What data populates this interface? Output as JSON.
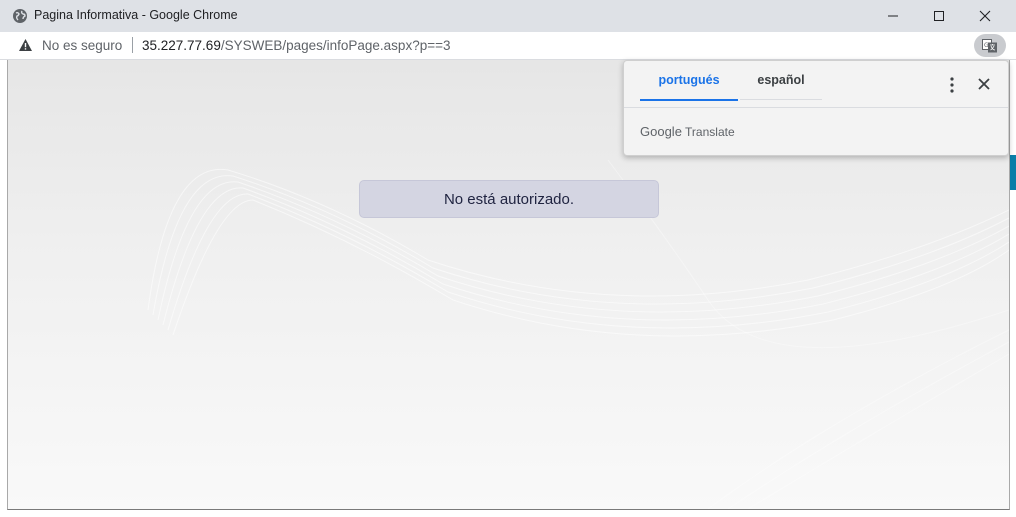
{
  "window": {
    "title": "Pagina Informativa - Google Chrome",
    "controls": [
      "minimize",
      "maximize",
      "close"
    ]
  },
  "addressbar": {
    "security_label": "No es seguro",
    "url_host": "35.227.77.69",
    "url_path": "/SYSWEB/pages/infoPage.aspx?p==3",
    "icons": [
      "warning-icon",
      "translate-icon"
    ]
  },
  "page": {
    "message": "No está autorizado."
  },
  "translate_popup": {
    "tabs": [
      {
        "label": "portugués",
        "selected": true
      },
      {
        "label": "español",
        "selected": false
      }
    ],
    "brand_google": "Google",
    "brand_translate": "Translate",
    "icons": [
      "more-vert-icon",
      "close-icon"
    ]
  },
  "colors": {
    "accent": "#1a73e8",
    "alert_bg": "#d4d5e2",
    "titlebar": "#dee1e6"
  }
}
